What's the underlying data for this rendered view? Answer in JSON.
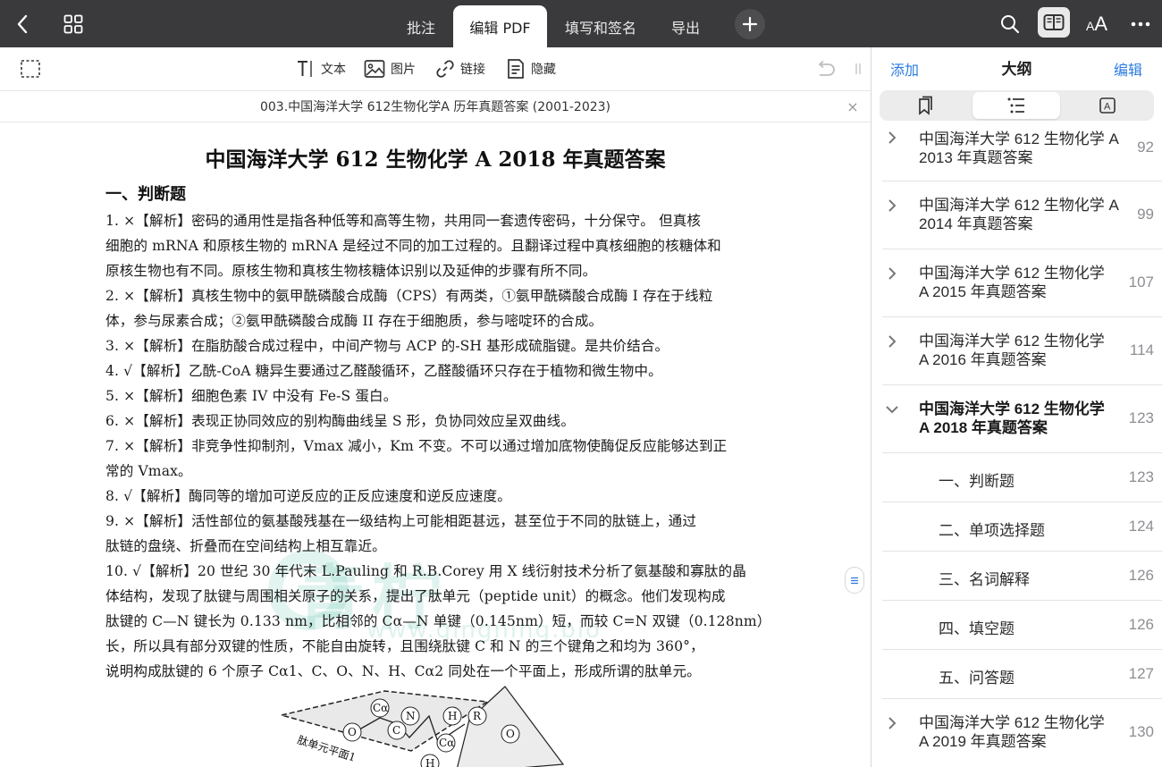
{
  "topbar": {
    "tabs": [
      {
        "label": "批注"
      },
      {
        "label": "编辑 PDF"
      },
      {
        "label": "填写和签名"
      },
      {
        "label": "导出"
      }
    ],
    "font_size_label": "AA"
  },
  "toolbar": {
    "text_label": "文本",
    "image_label": "图片",
    "link_label": "链接",
    "hide_label": "隐藏"
  },
  "document": {
    "filename": "003.中国海洋大学 612生物化学A 历年真题答案 (2001-2023)",
    "close_symbol": "×"
  },
  "page": {
    "title": "中国海洋大学 612 生物化学 A  2018 年真题答案",
    "section": "一、判断题",
    "lines": [
      "1. ×【解析】密码的通用性是指各种低等和高等生物，共用同一套遗传密码，十分保守。 但真核",
      "细胞的 mRNA 和原核生物的 mRNA 是经过不同的加工过程的。且翻译过程中真核细胞的核糖体和",
      "原核生物也有不同。原核生物和真核生物核糖体识别以及延伸的步骤有所不同。",
      "2. ×【解析】真核生物中的氨甲酰磷酸合成酶（CPS）有两类，①氨甲酰磷酸合成酶 I 存在于线粒",
      "体，参与尿素合成；②氨甲酰磷酸合成酶 II 存在于细胞质，参与嘧啶环的合成。",
      "3. ×【解析】在脂肪酸合成过程中，中间产物与 ACP 的-SH 基形成硫脂键。是共价结合。",
      "4. √【解析】乙酰-CoA 糖异生要通过乙醛酸循环，乙醛酸循环只存在于植物和微生物中。",
      "5. ×【解析】细胞色素 IV 中没有 Fe-S 蛋白。",
      "6. ×【解析】表现正协同效应的别构酶曲线呈 S 形，负协同效应呈双曲线。",
      "7. ×【解析】非竞争性抑制剂，Vmax 减小，Km 不变。不可以通过增加底物使酶促反应能够达到正",
      "常的 Vmax。",
      "8. √【解析】酶同等的增加可逆反应的正反应速度和逆反应速度。",
      "9.  ×【解析】活性部位的氨基酸残基在一级结构上可能相距甚远，甚至位于不同的肽链上，通过",
      "肽链的盘绕、折叠而在空间结构上相互靠近。",
      "10. √【解析】20 世纪 30 年代末 L.Pauling 和 R.B.Corey 用 X 线衍射技术分析了氨基酸和寡肽的晶",
      "体结构，发现了肽键与周围相关原子的关系，提出了肽单元（peptide unit）的概念。他们发现构成",
      "肽键的 C—N 键长为 0.133 nm，比相邻的 Cα—N 单键（0.145nm）短，而较 C=N 双键（0.128nm）",
      "长，所以具有部分双键的性质，不能自由旋转，且围绕肽键 C 和 N 的三个键角之和均为 360°，",
      "说明构成肽键的 6 个原子 Cα1、C、O、N、H、Cα2 同处在一个平面上，形成所谓的肽单元。"
    ],
    "watermark": "青柠",
    "watermark_url": "www.qingning.bio",
    "diagram_label": "肽单元平面1",
    "diagram_atoms": [
      "Cα",
      "N",
      "H",
      "R",
      "O",
      "C",
      "Cα",
      "O",
      "H"
    ]
  },
  "panel": {
    "add_label": "添加",
    "title": "大纲",
    "edit_label": "编辑",
    "outline": [
      {
        "title": "中国海洋大学 612 生物化学 A 2013 年真题答案",
        "line1": "中国海洋大学 612 生物化学 A",
        "line2": "2013 年真题答案",
        "page": "92",
        "expanded": false
      },
      {
        "title": "中国海洋大学 612 生物化学 A 2014 年真题答案",
        "line1": "中国海洋大学 612 生物化学 A",
        "line2": "2014 年真题答案",
        "page": "99",
        "expanded": false
      },
      {
        "title": "中国海洋大学 612 生物化学 A 2015 年真题答案",
        "line1": "中国海洋大学 612 生物化学",
        "line2": "A  2015 年真题答案",
        "page": "107",
        "expanded": false
      },
      {
        "title": "中国海洋大学 612 生物化学 A 2016 年真题答案",
        "line1": "中国海洋大学 612 生物化学",
        "line2": "A  2016 年真题答案",
        "page": "114",
        "expanded": false
      },
      {
        "title": "中国海洋大学 612 生物化学 A 2018 年真题答案",
        "line1": "中国海洋大学 612 生物化学",
        "line2": "A  2018 年真题答案",
        "page": "123",
        "expanded": true
      }
    ],
    "subitems": [
      {
        "label": "一、判断题",
        "page": "123"
      },
      {
        "label": "二、单项选择题",
        "page": "124"
      },
      {
        "label": "三、名词解释",
        "page": "126"
      },
      {
        "label": "四、填空题",
        "page": "126"
      },
      {
        "label": "五、问答题",
        "page": "127"
      }
    ],
    "last": {
      "line1": "中国海洋大学 612 生物化学",
      "line2": "A  2019 年真题答案",
      "page": "130"
    }
  },
  "colors": {
    "accent": "#2b7be0",
    "topbar_bg": "#3a3a3c",
    "watermark": "#46b9a0"
  }
}
